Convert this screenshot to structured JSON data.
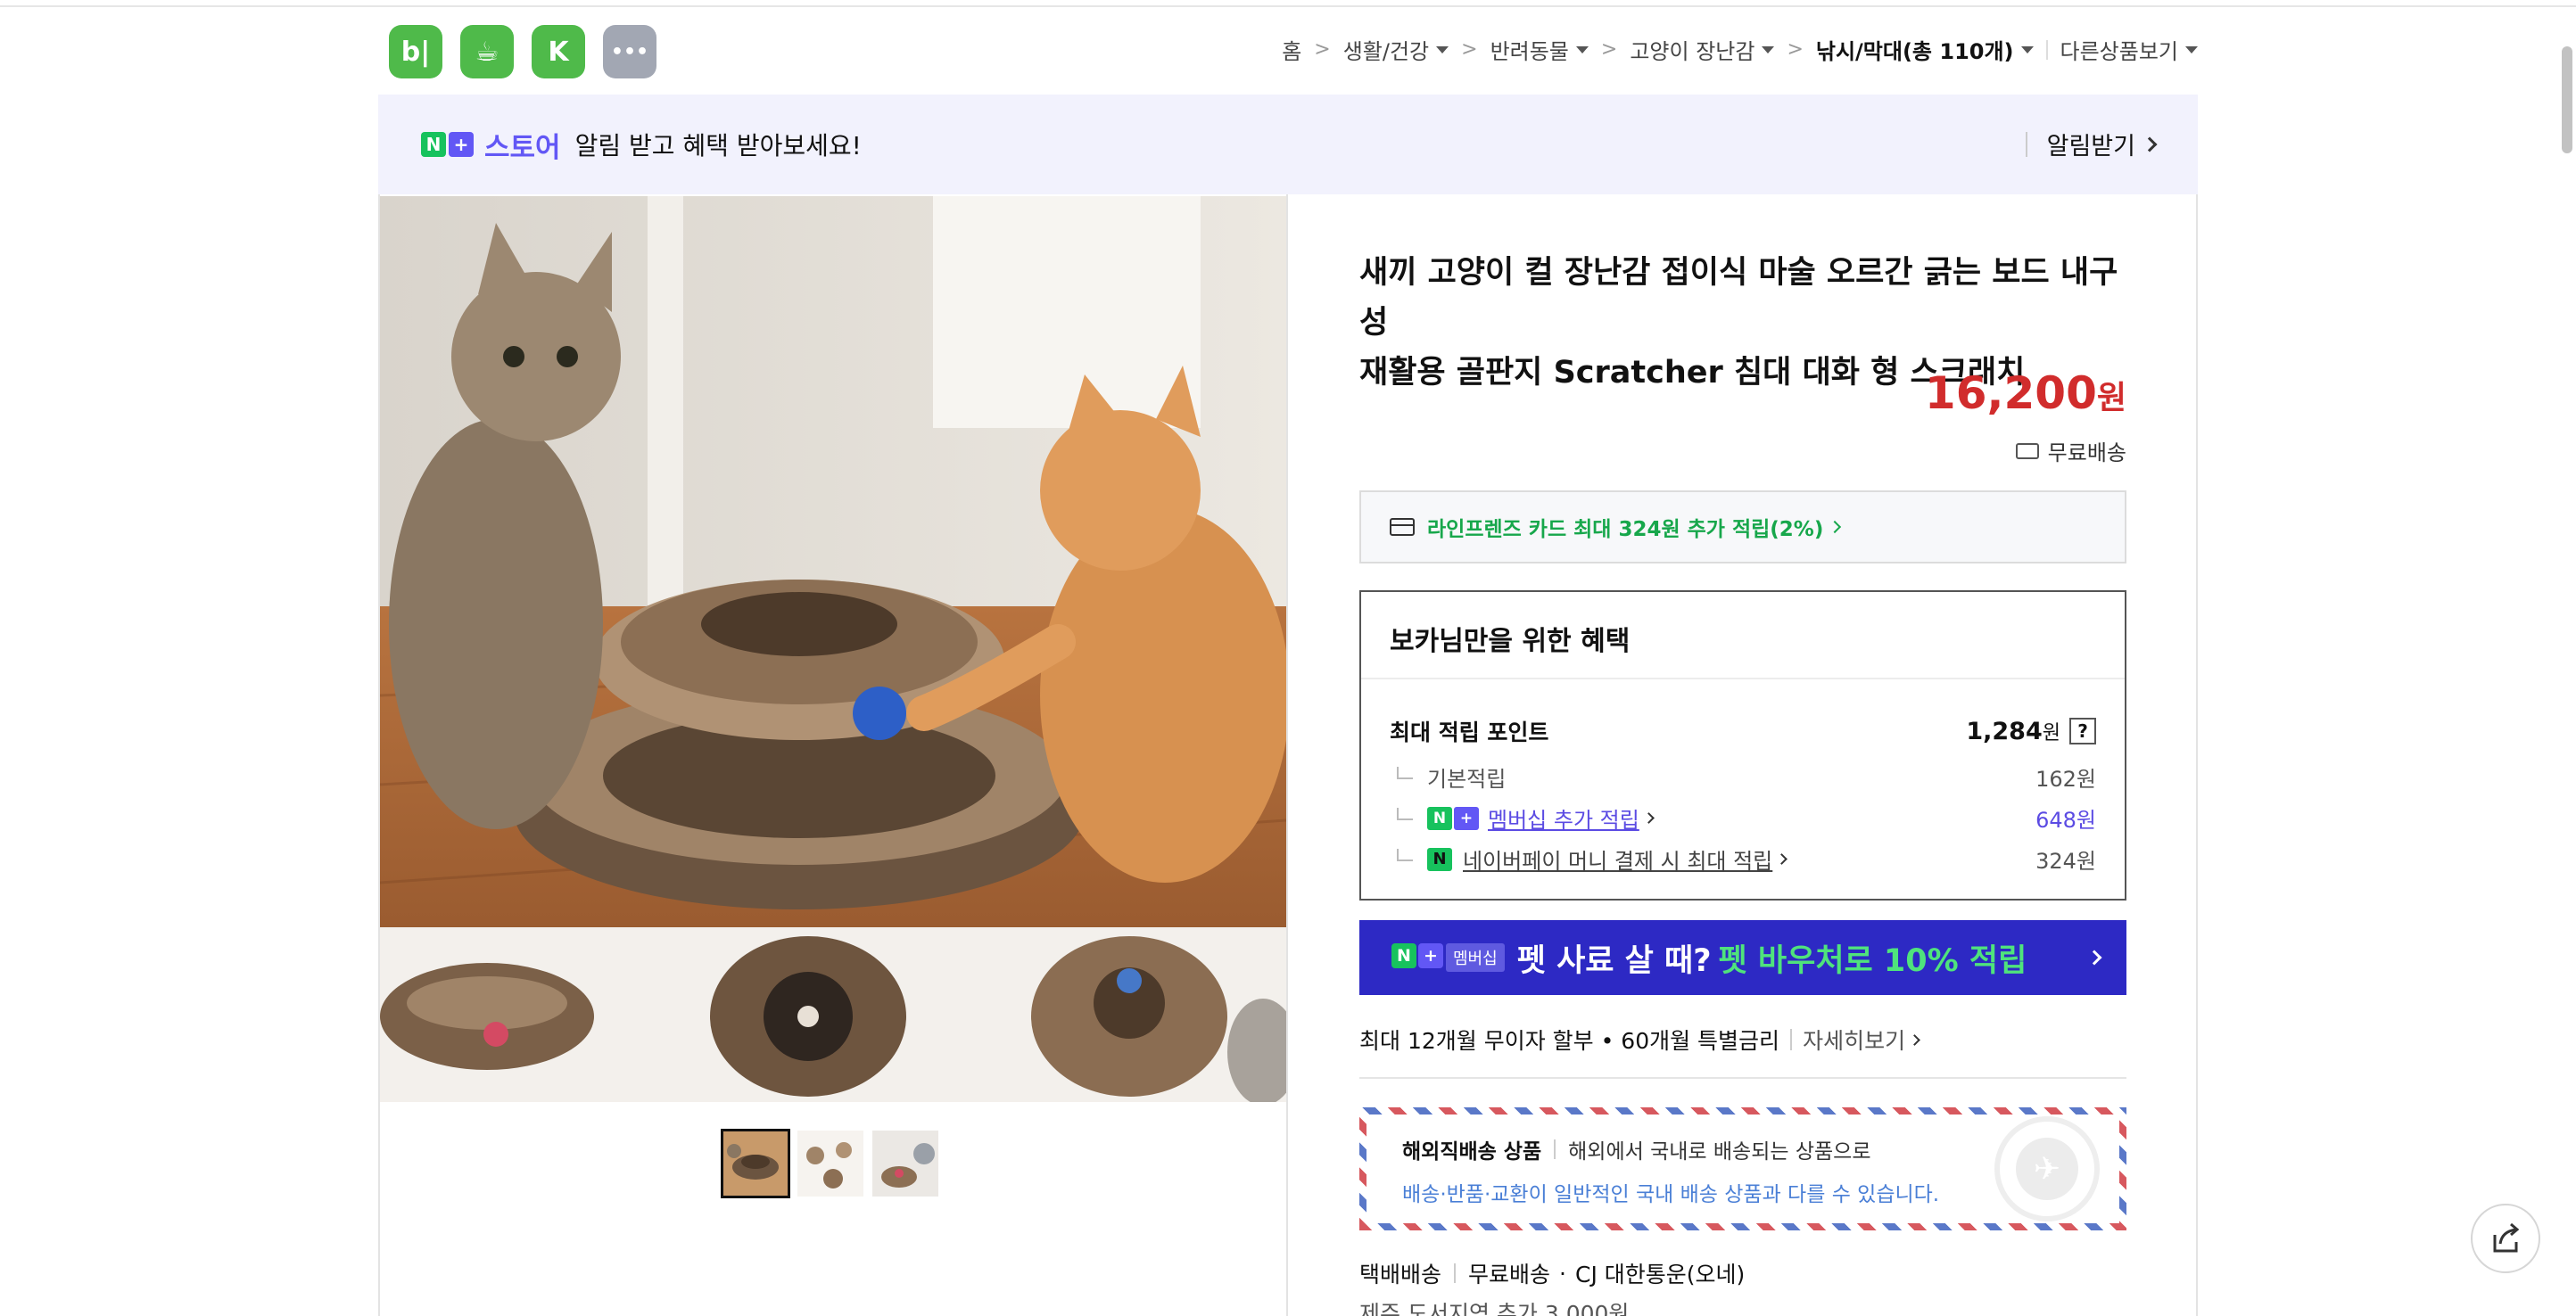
{
  "app_icons": [
    {
      "name": "blog-app",
      "glyph": "b|"
    },
    {
      "name": "cafe-app",
      "glyph": "☕"
    },
    {
      "name": "bookmark-app",
      "glyph": "K"
    },
    {
      "name": "more-app",
      "glyph": "•••"
    }
  ],
  "breadcrumb": {
    "items": [
      "홈",
      "생활/건강",
      "반려동물",
      "고양이 장난감",
      "낚시/막대(총 110개)"
    ],
    "other": "다른상품보기"
  },
  "notice": {
    "n_letter": "N",
    "plus": "+",
    "store_word": "스토어",
    "message": "알림 받고 혜택 받아보세요!",
    "action": "알림받기"
  },
  "product": {
    "title_line1": "새끼 고양이 컬 장난감 접이식 마술 오르간 긁는 보드 내구성",
    "title_line2": "재활용 골판지 Scratcher 침대 대화 형 스크래치",
    "price": "16,200",
    "currency": "원",
    "shipping": "무료배송"
  },
  "card_benefit": "라인프렌즈 카드 최대 324원 추가 적립(2%)",
  "benefit": {
    "title": "보카님만을 위한 혜택",
    "max_label": "최대 적립 포인트",
    "max_amount": "1,284",
    "won": "원",
    "help": "?",
    "rows": [
      {
        "label": "기본적립",
        "amount": "162원"
      },
      {
        "label": "멤버십 추가 적립",
        "amount": "648원"
      },
      {
        "label": "네이버페이 머니 결제 시 최대 적립",
        "amount": "324원"
      }
    ],
    "pay_glyph": "N"
  },
  "membership": {
    "label": "멤버십",
    "text1": "펫 사료 살 때?",
    "text2": "펫 바우처로 10% 적립"
  },
  "installment": {
    "text": "최대 12개월 무이자 할부 • 60개월 특별금리",
    "more": "자세히보기"
  },
  "overseas": {
    "title": "해외직배송 상품",
    "desc": "해외에서 국내로 배송되는 상품으로",
    "warning": "배송·반품·교환이 일반적인 국내 배송 상품과 다를 수 있습니다."
  },
  "delivery": {
    "method": "택배배송",
    "fee": "무료배송",
    "carrier": "CJ 대한통운(오네)",
    "extra": "제주 도서지역 추가 3,000원"
  },
  "colors": {
    "accent_green": "#17c25d",
    "accent_purple": "#6257f5",
    "price_red": "#d12c2c",
    "membership_bg": "#2d29c4"
  }
}
